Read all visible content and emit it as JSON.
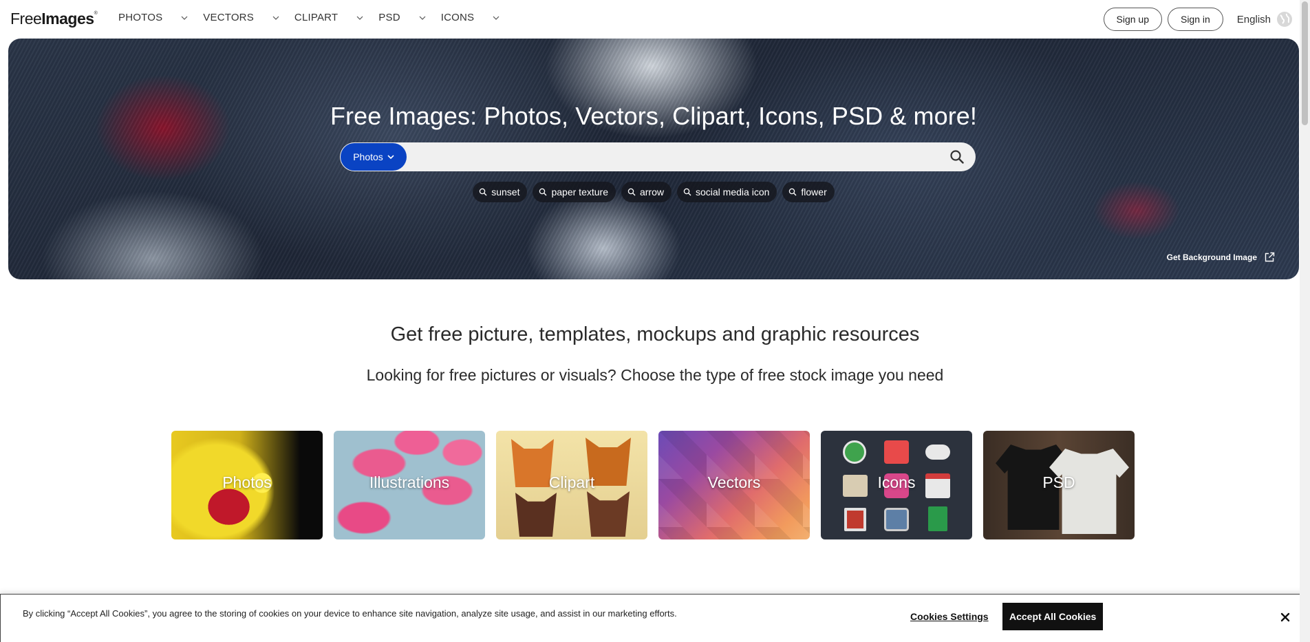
{
  "header": {
    "logo_regular": "Free",
    "logo_bold": "Images",
    "logo_reg": "®",
    "nav": [
      {
        "label": "PHOTOS"
      },
      {
        "label": "VECTORS"
      },
      {
        "label": "CLIPART"
      },
      {
        "label": "PSD"
      },
      {
        "label": "ICONS"
      }
    ],
    "signup_label": "Sign up",
    "signin_label": "Sign in",
    "language_label": "English"
  },
  "hero": {
    "title": "Free Images: Photos, Vectors, Clipart, Icons, PSD & more!",
    "search_type": "Photos",
    "search_placeholder": "",
    "tags": [
      "sunset",
      "paper texture",
      "arrow",
      "social media icon",
      "flower"
    ],
    "bg_link_label": "Get Background Image"
  },
  "intro": {
    "heading": "Get free picture, templates, mockups and graphic resources",
    "subheading": "Looking for free pictures or visuals? Choose the type of free stock image you need"
  },
  "categories": [
    "Photos",
    "Illustrations",
    "Clipart",
    "Vectors",
    "Icons",
    "PSD"
  ],
  "cookie": {
    "text": "By clicking “Accept All Cookies”, you agree to the storing of cookies on your device to enhance site navigation, analyze site usage, and assist in our marketing efforts.",
    "settings_label": "Cookies Settings",
    "accept_label": "Accept All Cookies"
  },
  "colors": {
    "accent": "#0a43c3",
    "cookie_button": "#111111"
  }
}
